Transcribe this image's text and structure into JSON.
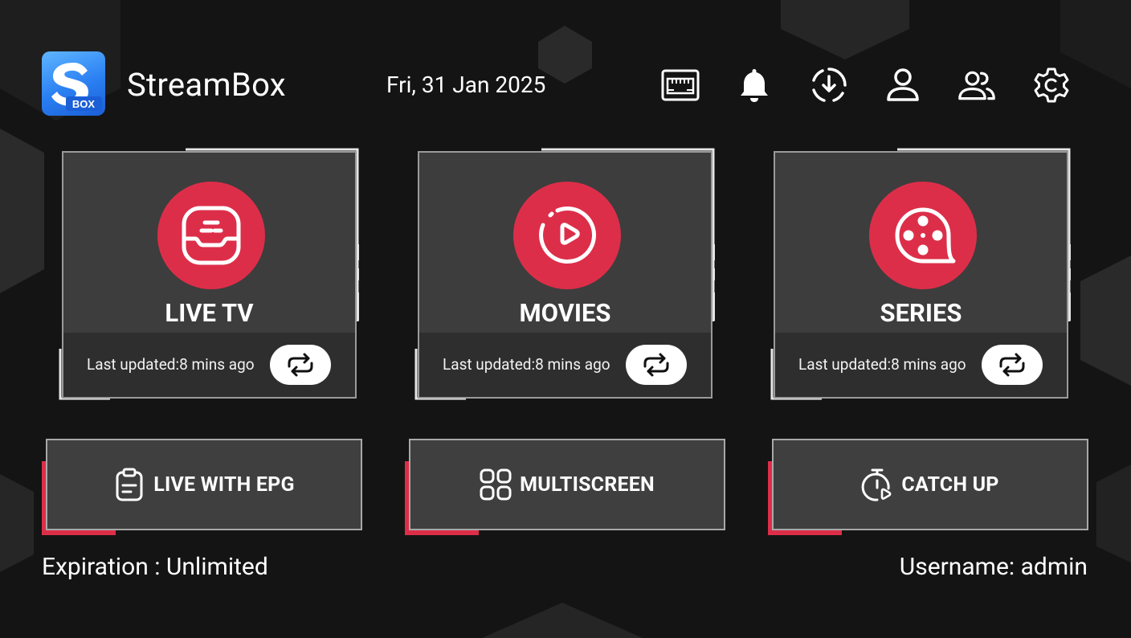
{
  "app": {
    "title": "StreamBox",
    "logo_text": "BOX",
    "logo_letter": "S"
  },
  "header": {
    "date": "Fri, 31 Jan 2025",
    "icons": [
      "network-icon",
      "bell-icon",
      "download-icon",
      "user-icon",
      "users-icon",
      "settings-icon"
    ]
  },
  "cards": [
    {
      "label": "LIVE TV",
      "updated": "Last updated:8 mins ago",
      "icon": "live-tv-icon"
    },
    {
      "label": "MOVIES",
      "updated": "Last updated:8 mins ago",
      "icon": "play-circle-icon"
    },
    {
      "label": "SERIES",
      "updated": "Last updated:8 mins ago",
      "icon": "film-reel-icon"
    }
  ],
  "buttons": [
    {
      "label": "LIVE WITH EPG",
      "icon": "clipboard-icon"
    },
    {
      "label": "MULTISCREEN",
      "icon": "grid-icon"
    },
    {
      "label": "CATCH UP",
      "icon": "timer-play-icon"
    }
  ],
  "footer": {
    "expiration": "Expiration :  Unlimited",
    "username": "Username: admin"
  },
  "colors": {
    "accent": "#dd2e49",
    "background": "#141414",
    "card": "#3d3d3d"
  }
}
